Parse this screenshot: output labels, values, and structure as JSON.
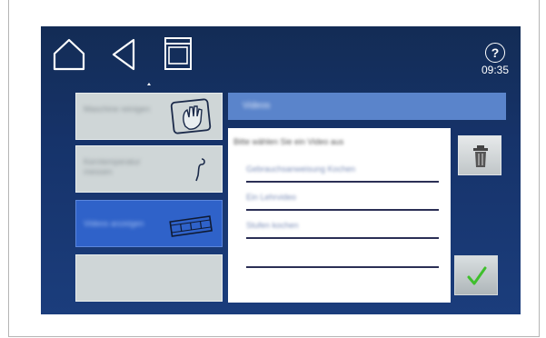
{
  "header": {
    "home_icon": "home-icon",
    "back_icon": "back-triangle-icon",
    "oven_icon": "oven-icon",
    "help_symbol": "?",
    "time": "09:35"
  },
  "sidebar": {
    "items": [
      {
        "label": "Maschine reinigen",
        "icon": "cleaning-hand-icon",
        "active": false
      },
      {
        "label": "Kerntemperatur messen",
        "icon": "core-probe-icon",
        "active": false
      },
      {
        "label": "Videos anzeigen",
        "icon": "film-strip-icon",
        "active": true
      },
      {
        "label": "",
        "icon": "",
        "active": false
      }
    ]
  },
  "panel": {
    "title": "Videos",
    "prompt": "Bitte wählen Sie ein Video aus",
    "options": [
      "Gebrauchsanweisung Kochen",
      "Ein Lehrvideo",
      "Stufen kochen",
      ""
    ]
  },
  "actions": {
    "delete_icon": "trash-icon",
    "confirm_icon": "checkmark-icon"
  },
  "colors": {
    "screen_bg": "#16336a",
    "active_item": "#2f62c9",
    "panel_header": "#5a84cb",
    "check_green": "#3fbf2d"
  }
}
